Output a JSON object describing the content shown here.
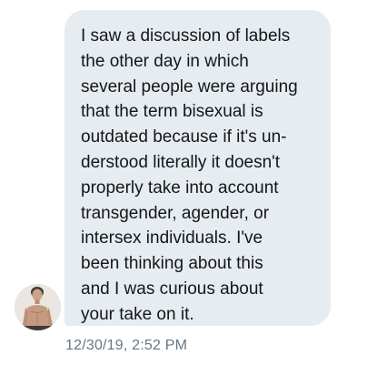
{
  "conversation": {
    "message": {
      "text": "I saw a discussion of labels\nthe other day in which\nseveral people were arguing\nthat the term bisexual is\noutdated because if it's un-\nderstood literally it doesn't\nproperly take into account\ntransgender, agender, or\nintersex individuals. I've\nbeen thinking about this\nand I was curious about\nyour take on it.",
      "timestamp": "12/30/19, 2:52 PM",
      "bubble_color": "#e6ecf0",
      "text_color": "#14171a",
      "timestamp_color": "#657786"
    },
    "sender": {
      "avatar_icon": "user-avatar-photo"
    }
  }
}
